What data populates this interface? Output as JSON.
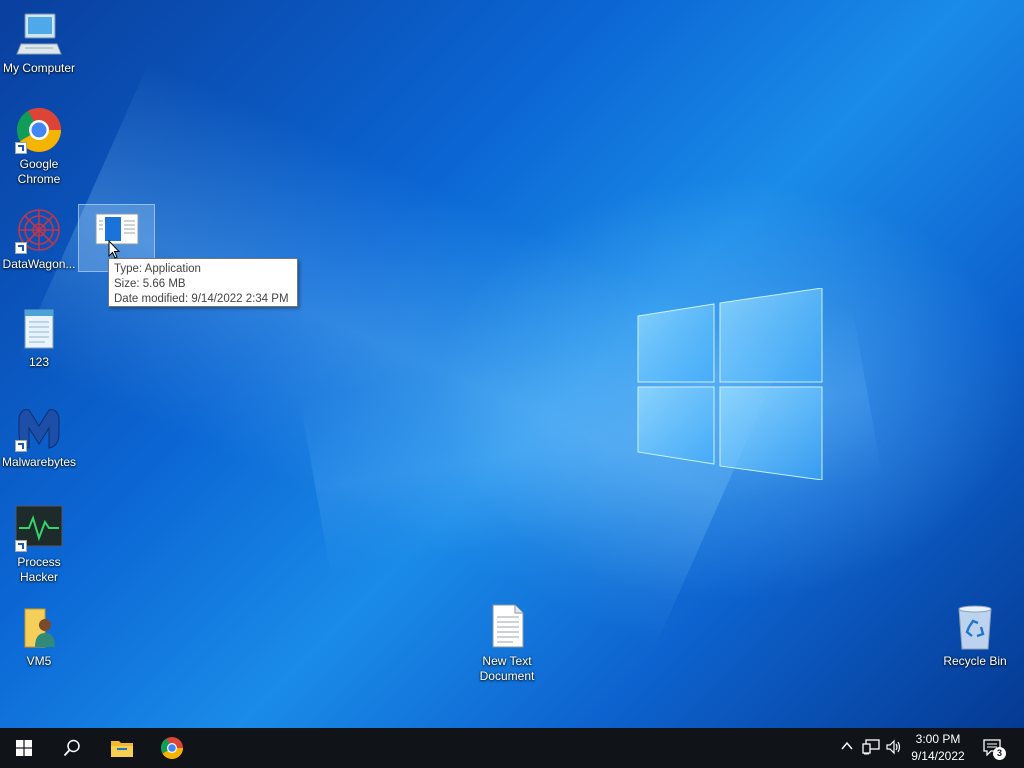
{
  "desktop": {
    "icons": [
      {
        "name": "my-computer",
        "label": "My Computer",
        "icon": "computer-icon"
      },
      {
        "name": "google-chrome",
        "label": "Google Chrome",
        "icon": "chrome-icon",
        "shortcut": true
      },
      {
        "name": "datawagon",
        "label": "DataWagon...",
        "icon": "datawagon-icon",
        "shortcut": true
      },
      {
        "name": "selected-app",
        "label": "r",
        "icon": "application-icon",
        "selected": true
      },
      {
        "name": "file-123",
        "label": "123",
        "icon": "notepad-icon"
      },
      {
        "name": "malwarebytes",
        "label": "Malwarebytes",
        "icon": "malwarebytes-icon",
        "shortcut": true
      },
      {
        "name": "process-hacker",
        "label": "Process Hacker",
        "icon": "process-hacker-icon",
        "shortcut": true
      },
      {
        "name": "vm5",
        "label": "VM5",
        "icon": "user-folder-icon"
      },
      {
        "name": "new-text-document",
        "label": "New Text Document",
        "icon": "text-document-icon"
      },
      {
        "name": "recycle-bin",
        "label": "Recycle Bin",
        "icon": "recycle-bin-icon"
      }
    ],
    "tooltip": {
      "type": "Type: Application",
      "size": "Size: 5.66 MB",
      "date_modified": "Date modified: 9/14/2022 2:34 PM"
    }
  },
  "taskbar": {
    "buttons": [
      {
        "name": "start-button",
        "icon": "windows-icon"
      },
      {
        "name": "search-button",
        "icon": "search-icon"
      },
      {
        "name": "file-explorer-button",
        "icon": "folder-icon"
      },
      {
        "name": "chrome-taskbar-button",
        "icon": "chrome-icon"
      }
    ],
    "tray": {
      "time": "3:00 PM",
      "date": "9/14/2022",
      "notification_count": "3"
    }
  },
  "colors": {
    "taskbar": "#101418",
    "desktop_accent": "#0b66d4"
  }
}
